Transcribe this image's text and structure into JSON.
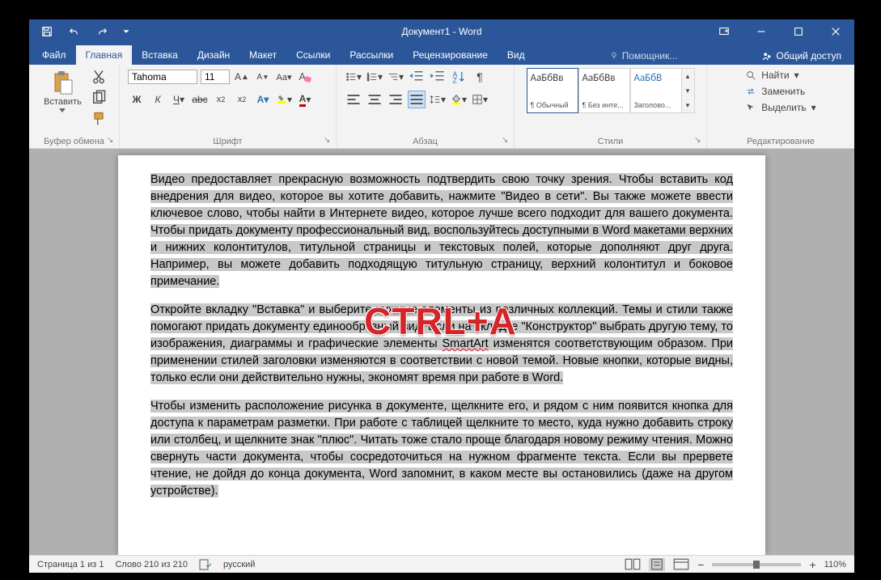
{
  "titlebar": {
    "title": "Документ1 - Word"
  },
  "menu": {
    "tabs": [
      "Файл",
      "Главная",
      "Вставка",
      "Дизайн",
      "Макет",
      "Ссылки",
      "Рассылки",
      "Рецензирование",
      "Вид"
    ],
    "active_index": 1,
    "tellme": "Помощник...",
    "share": "Общий доступ"
  },
  "ribbon": {
    "clipboard": {
      "label": "Буфер обмена",
      "paste": "Вставить"
    },
    "font": {
      "label": "Шрифт",
      "name": "Tahoma",
      "size": "11",
      "bold": "Ж",
      "italic": "К",
      "underline": "Ч",
      "strike": "abc"
    },
    "paragraph": {
      "label": "Абзац"
    },
    "styles": {
      "label": "Стили",
      "items": [
        {
          "sample": "АаБбВв",
          "name": "¶ Обычный"
        },
        {
          "sample": "АаБбВв",
          "name": "¶ Без инте..."
        },
        {
          "sample": "АаБбВ",
          "name": "Заголово..."
        }
      ]
    },
    "editing": {
      "label": "Редактирование",
      "find": "Найти",
      "replace": "Заменить",
      "select": "Выделить"
    }
  },
  "document": {
    "p1": "Видео предоставляет прекрасную возможность подтвердить свою точку зрения. Чтобы вставить код внедрения для видео, которое вы хотите добавить, нажмите \"Видео в сети\". Вы также можете ввести ключевое слово, чтобы найти в Интернете видео, которое лучше всего подходит для вашего документа. Чтобы придать документу профессиональный вид, воспользуйтесь доступными в Word макетами верхних и нижних колонтитулов, титульной страницы и текстовых полей, которые дополняют друг друга. Например, вы можете добавить подходящую титульную страницу, верхний колонтитул и боковое примечание.",
    "p2_a": "Откройте вкладку \"Вставка\" и выберите нужные элементы из различных коллекций. Темы и стили также помогают придать документу единообразный вид. Если на вкладке \"Конструктор\" выбрать другую тему, то изображения, диаграммы и графические элементы ",
    "p2_smart": "SmartArt",
    "p2_b": " изменятся соответствующим образом. При применении стилей заголовки изменяются в соответствии с новой темой. Новые кнопки, которые видны, только если они действительно нужны, экономят время при работе в Word.",
    "p3": "Чтобы изменить расположение рисунка в документе, щелкните его, и рядом с ним появится кнопка для доступа к параметрам разметки. При работе с таблицей щелкните то место, куда нужно добавить строку или столбец, и щелкните знак \"плюс\". Читать тоже стало проще благодаря новому режиму чтения. Можно свернуть части документа, чтобы сосредоточиться на нужном фрагменте текста. Если вы прервете чтение, не дойдя до конца документа, Word запомнит, в каком месте вы остановились (даже на другом устройстве)."
  },
  "overlay": {
    "text": "CTRL+A"
  },
  "statusbar": {
    "page": "Страница 1 из 1",
    "words": "Слово 210 из 210",
    "lang": "русский",
    "zoom": "110%",
    "minus": "−",
    "plus": "+"
  }
}
